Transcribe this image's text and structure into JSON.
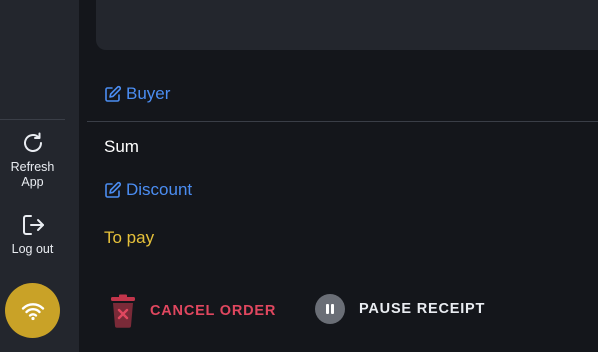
{
  "sidebar": {
    "refresh_label": "Refresh\nApp",
    "refresh_icon": "refresh-icon",
    "logout_label": "Log out",
    "logout_icon": "logout-icon",
    "connection_icon": "wifi-icon",
    "connection_color": "#c9a227"
  },
  "main": {
    "buyer_label": "Buyer",
    "sum_label": "Sum",
    "discount_label": "Discount",
    "topay_label": "To pay"
  },
  "actions": {
    "cancel_label": "CANCEL ORDER",
    "cancel_icon": "trash-icon",
    "pause_label": "PAUSE RECEIPT",
    "pause_icon": "pause-icon"
  },
  "colors": {
    "link": "#4b8df2",
    "topay": "#e6c13a",
    "danger": "#e0475f"
  }
}
